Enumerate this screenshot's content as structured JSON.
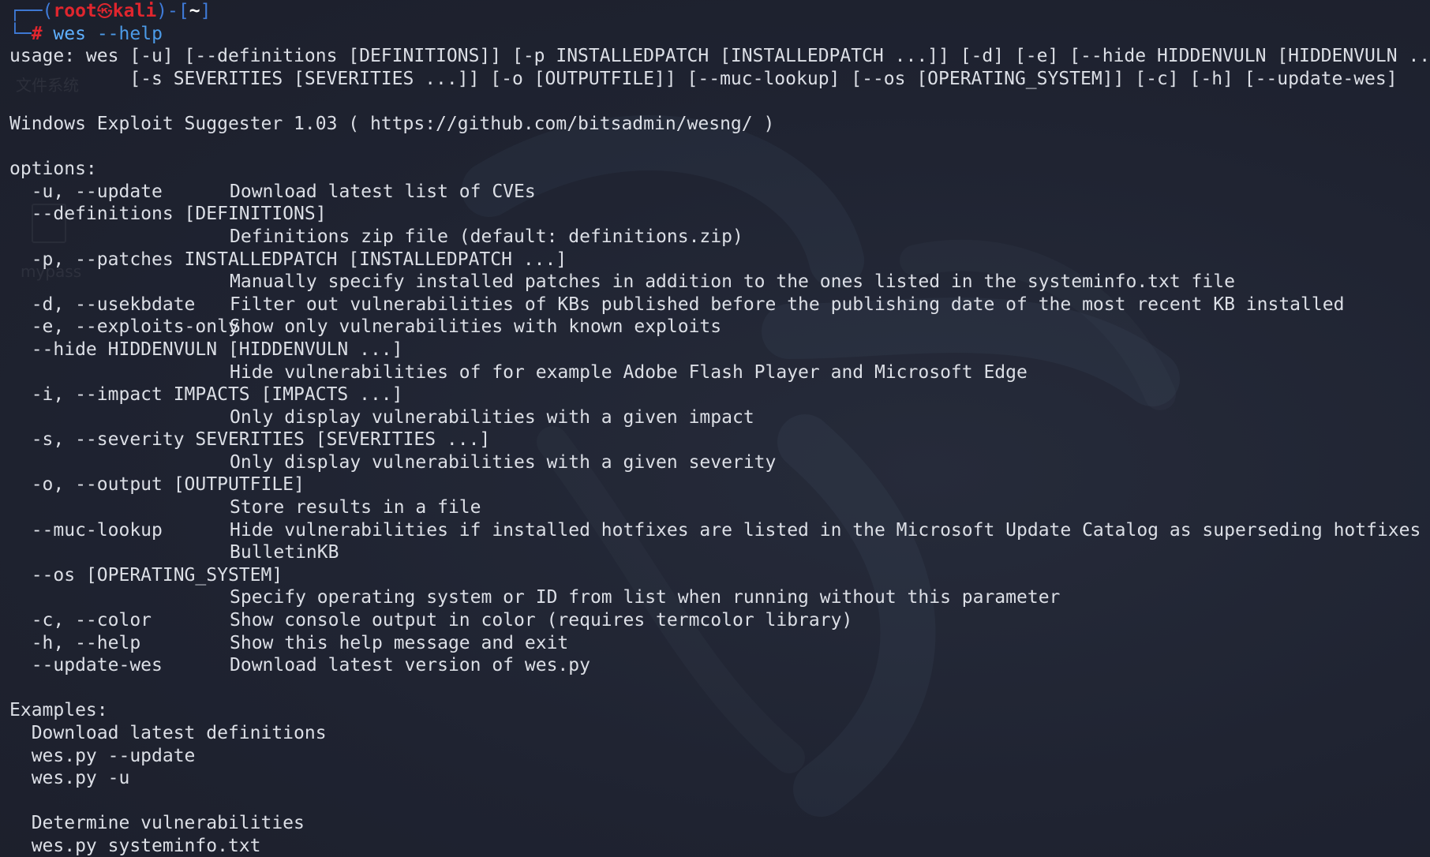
{
  "prompt": {
    "frame_top": "┌──(",
    "user": "root",
    "skull": "㉿",
    "host": "kali",
    "frame_mid": ")-[",
    "path": "~",
    "frame_end": "]",
    "frame_bottom": "└─",
    "hash": "#",
    "command": "wes",
    "args": "--help"
  },
  "usage": [
    "usage: wes [-u] [--definitions [DEFINITIONS]] [-p INSTALLEDPATCH [INSTALLEDPATCH ...]] [-d] [-e] [--hide HIDDENVULN [HIDDENVULN ...]]",
    "           [-s SEVERITIES [SEVERITIES ...]] [-o [OUTPUTFILE]] [--muc-lookup] [--os [OPERATING_SYSTEM]] [-c] [-h] [--update-wes]"
  ],
  "title_line": "Windows Exploit Suggester 1.03 ( https://github.com/bitsadmin/wesng/ )",
  "options_header": "options:",
  "options": [
    {
      "flag": "  -u, --update",
      "desc": "Download latest list of CVEs"
    },
    {
      "flag": "  --definitions [DEFINITIONS]",
      "desc": ""
    },
    {
      "flag": "",
      "desc": "Definitions zip file (default: definitions.zip)"
    },
    {
      "flag": "  -p, --patches INSTALLEDPATCH [INSTALLEDPATCH ...]",
      "desc": ""
    },
    {
      "flag": "",
      "desc": "Manually specify installed patches in addition to the ones listed in the systeminfo.txt file"
    },
    {
      "flag": "  -d, --usekbdate",
      "desc": "Filter out vulnerabilities of KBs published before the publishing date of the most recent KB installed"
    },
    {
      "flag": "  -e, --exploits-only",
      "desc": "Show only vulnerabilities with known exploits"
    },
    {
      "flag": "  --hide HIDDENVULN [HIDDENVULN ...]",
      "desc": ""
    },
    {
      "flag": "",
      "desc": "Hide vulnerabilities of for example Adobe Flash Player and Microsoft Edge"
    },
    {
      "flag": "  -i, --impact IMPACTS [IMPACTS ...]",
      "desc": ""
    },
    {
      "flag": "",
      "desc": "Only display vulnerabilities with a given impact"
    },
    {
      "flag": "  -s, --severity SEVERITIES [SEVERITIES ...]",
      "desc": ""
    },
    {
      "flag": "",
      "desc": "Only display vulnerabilities with a given severity"
    },
    {
      "flag": "  -o, --output [OUTPUTFILE]",
      "desc": ""
    },
    {
      "flag": "",
      "desc": "Store results in a file"
    },
    {
      "flag": "  --muc-lookup",
      "desc": "Hide vulnerabilities if installed hotfixes are listed in the Microsoft Update Catalog as superseding hotfixes"
    },
    {
      "flag": "",
      "desc": "BulletinKB"
    },
    {
      "flag": "  --os [OPERATING_SYSTEM]",
      "desc": ""
    },
    {
      "flag": "",
      "desc": "Specify operating system or ID from list when running without this parameter"
    },
    {
      "flag": "  -c, --color",
      "desc": "Show console output in color (requires termcolor library)"
    },
    {
      "flag": "  -h, --help",
      "desc": "Show this help message and exit"
    },
    {
      "flag": "  --update-wes",
      "desc": "Download latest version of wes.py"
    }
  ],
  "examples_header": "Examples:",
  "examples": [
    "  Download latest definitions",
    "  wes.py --update",
    "  wes.py -u",
    "",
    "  Determine vulnerabilities",
    "  wes.py systeminfo.txt"
  ],
  "desktop_ghost": {
    "label_fs": "文件系统",
    "label_mypass": "mypass"
  }
}
